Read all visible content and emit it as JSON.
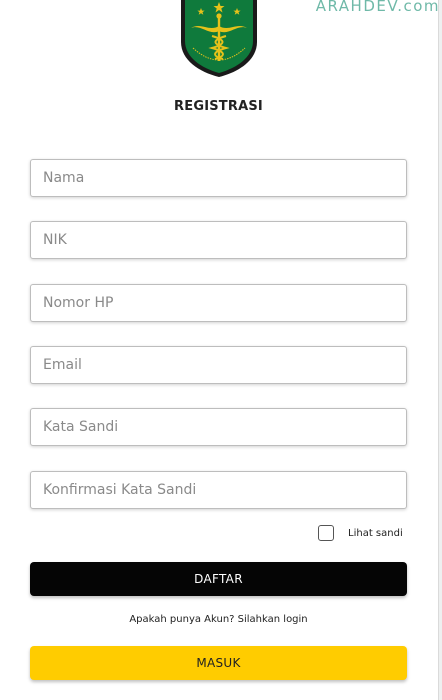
{
  "header": {
    "watermark": "ARAHDEV.com",
    "title": "REGISTRASI"
  },
  "form": {
    "fields": [
      {
        "placeholder": "Nama",
        "value": ""
      },
      {
        "placeholder": "NIK",
        "value": ""
      },
      {
        "placeholder": "Nomor HP",
        "value": ""
      },
      {
        "placeholder": "Email",
        "value": ""
      },
      {
        "placeholder": "Kata Sandi",
        "value": ""
      },
      {
        "placeholder": "Konfirmasi Kata Sandi",
        "value": ""
      }
    ],
    "show_password_label": "Lihat sandi",
    "show_password_checked": false,
    "register_label": "DAFTAR",
    "login_hint": "Apakah punya Akun? Silahkan login",
    "login_label": "MASUK"
  },
  "colors": {
    "register_bg": "#050505",
    "login_bg": "#ffcc00",
    "watermark": "#6fb9a8",
    "logo_green": "#0f7a3c",
    "logo_gold": "#e6c21a"
  },
  "icons": {
    "logo": "caduceus-shield-logo-icon",
    "checkbox": "checkbox-icon"
  }
}
